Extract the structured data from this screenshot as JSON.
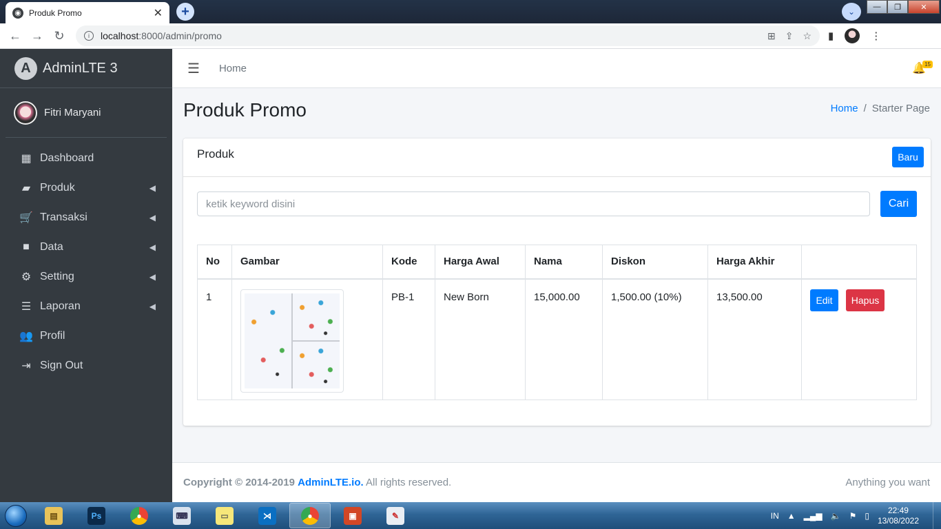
{
  "browser": {
    "tab_title": "Produk Promo",
    "url_host": "localhost",
    "url_rest": ":8000/admin/promo"
  },
  "sidebar": {
    "brand": "AdminLTE 3",
    "user_name": "Fitri Maryani",
    "items": [
      {
        "label": "Dashboard",
        "icon": "grid-icon",
        "has_arrow": false
      },
      {
        "label": "Produk",
        "icon": "folder-open-icon",
        "has_arrow": true
      },
      {
        "label": "Transaksi",
        "icon": "cart-icon",
        "has_arrow": true
      },
      {
        "label": "Data",
        "icon": "folder-icon",
        "has_arrow": true
      },
      {
        "label": "Setting",
        "icon": "gears-icon",
        "has_arrow": true
      },
      {
        "label": "Laporan",
        "icon": "list-icon",
        "has_arrow": true
      },
      {
        "label": "Profil",
        "icon": "users-icon",
        "has_arrow": false
      },
      {
        "label": "Sign Out",
        "icon": "sign-out-icon",
        "has_arrow": false
      }
    ]
  },
  "topnav": {
    "home_label": "Home",
    "notification_count": "15"
  },
  "header": {
    "page_title": "Produk Promo",
    "breadcrumb_home": "Home",
    "breadcrumb_current": "Starter Page"
  },
  "card": {
    "title": "Produk",
    "new_button": "Baru",
    "search_placeholder": "ketik keyword disini",
    "search_button": "Cari"
  },
  "table": {
    "headers": [
      "No",
      "Gambar",
      "Kode",
      "Harga Awal",
      "Nama",
      "Diskon",
      "Harga Akhir",
      ""
    ],
    "rows": [
      {
        "no": "1",
        "kode": "PB-1",
        "harga_awal": "New Born",
        "nama": "15,000.00",
        "diskon": "1,500.00 (10%)",
        "harga_akhir": "13,500.00",
        "edit_label": "Edit",
        "delete_label": "Hapus"
      }
    ]
  },
  "footer": {
    "copyright_prefix": "Copyright © 2014-2019",
    "brand_link": "AdminLTE.io.",
    "rights": "All rights reserved.",
    "right_text": "Anything you want"
  },
  "taskbar": {
    "language": "IN",
    "time": "22:49",
    "date": "13/08/2022"
  },
  "colors": {
    "primary": "#007bff",
    "danger": "#dc3545",
    "sidebar_bg": "#343a40",
    "badge": "#ffc107"
  }
}
